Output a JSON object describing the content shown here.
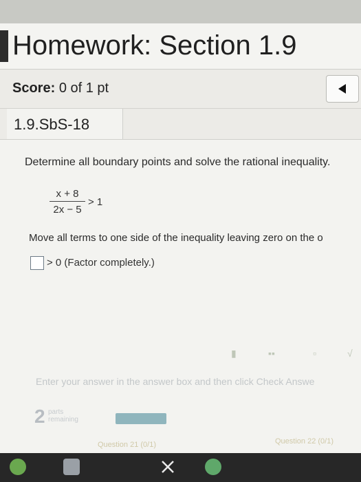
{
  "header": {
    "title": "Homework: Section 1.9",
    "score_label": "Score:",
    "score_value": "0 of 1 pt",
    "question_id": "1.9.SbS-18"
  },
  "question": {
    "instruction": "Determine all boundary points and solve the rational inequality.",
    "numerator": "x + 8",
    "denominator": "2x − 5",
    "comparison": "> 1",
    "step_text": "Move all terms to one side of the inequality leaving zero on the o",
    "answer_suffix": "> 0 (Factor completely.)"
  },
  "footer": {
    "hint": "Enter your answer in the answer box and then click Check Answe",
    "parts_count": "2",
    "parts_label_1": "parts",
    "parts_label_2": "remaining",
    "question_prev": "Question 21 (0/1)",
    "question_next": "Question 22 (0/1)"
  },
  "colors": {
    "accent": "#8fb5bd",
    "taskbar": "#272727"
  }
}
